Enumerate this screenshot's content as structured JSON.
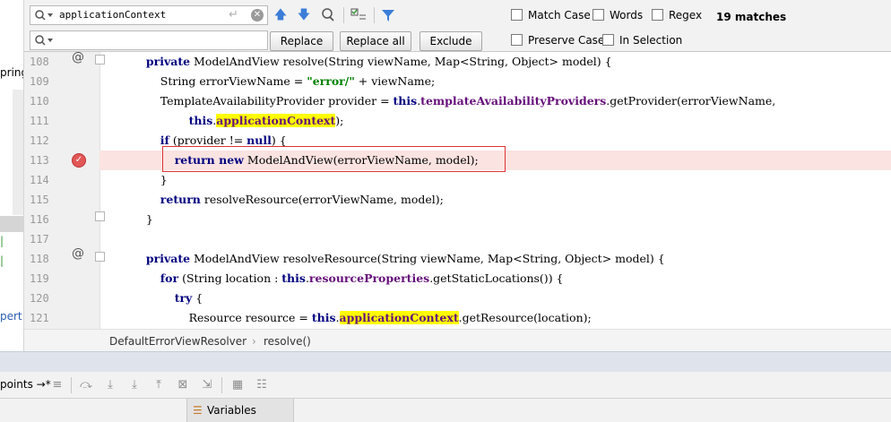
{
  "find": {
    "query": "applicationContext",
    "replace_value": "",
    "matches": "19 matches",
    "buttons": {
      "replace": "Replace",
      "replace_all": "Replace all",
      "exclude": "Exclude"
    },
    "options": {
      "match_case": "Match Case",
      "words": "Words",
      "regex": "Regex",
      "preserve_case": "Preserve Case",
      "in_selection": "In Selection"
    }
  },
  "left_panel": {
    "fragments": [
      "pring",
      "pert"
    ]
  },
  "lines": [
    {
      "n": "108",
      "parts": [
        [
          "",
          "    "
        ],
        [
          "kw",
          "private"
        ],
        [
          "",
          " ModelAndView resolve(String viewName, Map<String, Object> model) {"
        ]
      ]
    },
    {
      "n": "109",
      "parts": [
        [
          "",
          "        String errorViewName = "
        ],
        [
          "str",
          "\"error/\""
        ],
        [
          "",
          " + viewName;"
        ]
      ]
    },
    {
      "n": "110",
      "parts": [
        [
          "",
          "        TemplateAvailabilityProvider provider = "
        ],
        [
          "kw",
          "this"
        ],
        [
          "",
          "."
        ],
        [
          "fld",
          "templateAvailabilityProviders"
        ],
        [
          "",
          ".getProvider(errorViewName,"
        ]
      ]
    },
    {
      "n": "111",
      "parts": [
        [
          "",
          "                "
        ],
        [
          "kw",
          "this"
        ],
        [
          "",
          "."
        ],
        [
          "fld hl",
          "applicationContext"
        ],
        [
          "",
          ");"
        ]
      ]
    },
    {
      "n": "112",
      "parts": [
        [
          "",
          "        "
        ],
        [
          "kw",
          "if"
        ],
        [
          "",
          " (provider != "
        ],
        [
          "kw",
          "null"
        ],
        [
          "",
          ") {"
        ]
      ]
    },
    {
      "n": "113",
      "parts": [
        [
          "",
          "            "
        ],
        [
          "kw",
          "return new"
        ],
        [
          "",
          " ModelAndView(errorViewName, model);"
        ]
      ]
    },
    {
      "n": "114",
      "parts": [
        [
          "",
          "        }"
        ]
      ]
    },
    {
      "n": "115",
      "parts": [
        [
          "",
          "        "
        ],
        [
          "kw",
          "return"
        ],
        [
          "",
          " resolveResource(errorViewName, model);"
        ]
      ]
    },
    {
      "n": "116",
      "parts": [
        [
          "",
          "    }"
        ]
      ]
    },
    {
      "n": "117",
      "parts": [
        [
          "",
          ""
        ]
      ]
    },
    {
      "n": "118",
      "parts": [
        [
          "",
          "    "
        ],
        [
          "kw",
          "private"
        ],
        [
          "",
          " ModelAndView resolveResource(String viewName, Map<String, Object> model) {"
        ]
      ]
    },
    {
      "n": "119",
      "parts": [
        [
          "",
          "        "
        ],
        [
          "kw",
          "for"
        ],
        [
          "",
          " (String location : "
        ],
        [
          "kw",
          "this"
        ],
        [
          "",
          "."
        ],
        [
          "fld",
          "resourceProperties"
        ],
        [
          "",
          ".getStaticLocations()) {"
        ]
      ]
    },
    {
      "n": "120",
      "parts": [
        [
          "",
          "            "
        ],
        [
          "kw",
          "try"
        ],
        [
          "",
          " {"
        ]
      ]
    },
    {
      "n": "121",
      "parts": [
        [
          "",
          "                Resource resource = "
        ],
        [
          "kw",
          "this"
        ],
        [
          "",
          "."
        ],
        [
          "fld hl",
          "applicationContext"
        ],
        [
          "",
          ".getResource(location);"
        ]
      ]
    }
  ],
  "breadcrumb": {
    "class_name": "DefaultErrorViewResolver",
    "method": "resolve()"
  },
  "debug": {
    "tab_label": "points"
  },
  "variables": {
    "tab_label": "Variables"
  },
  "colors": {
    "keyword": "#000080",
    "string": "#008000",
    "field": "#660e7a",
    "highlight": "#ffff00",
    "breakpoint": "#e25757"
  }
}
